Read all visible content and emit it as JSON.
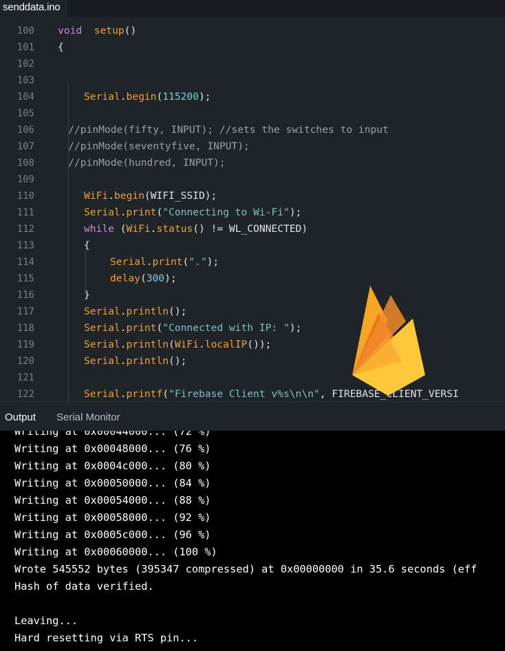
{
  "file_tab": {
    "label": "senddata.ino"
  },
  "editor": {
    "lines": [
      {
        "n": "100",
        "parts": [
          [
            "kw",
            "void"
          ],
          [
            "",
            "  "
          ],
          [
            "fn",
            "setup"
          ],
          [
            "",
            "()"
          ]
        ],
        "indent": 0
      },
      {
        "n": "101",
        "parts": [
          [
            "",
            "{"
          ]
        ],
        "indent": 0
      },
      {
        "n": "102",
        "parts": [],
        "indent": 0
      },
      {
        "n": "103",
        "parts": [],
        "indent": 0
      },
      {
        "n": "104",
        "parts": [
          [
            "cls",
            "Serial"
          ],
          [
            "",
            "."
          ],
          [
            "fn",
            "begin"
          ],
          [
            "",
            "("
          ],
          [
            "num",
            "115200"
          ],
          [
            "",
            ");"
          ]
        ],
        "indent": 1
      },
      {
        "n": "105",
        "parts": [],
        "indent": 0
      },
      {
        "n": "106",
        "parts": [
          [
            "cmt",
            "//pinMode(fifty, INPUT); //sets the switches to input"
          ]
        ],
        "indent": 0.4
      },
      {
        "n": "107",
        "parts": [
          [
            "cmt",
            "//pinMode(seventyfive, INPUT);"
          ]
        ],
        "indent": 0.4
      },
      {
        "n": "108",
        "parts": [
          [
            "cmt",
            "//pinMode(hundred, INPUT);"
          ]
        ],
        "indent": 0.4
      },
      {
        "n": "109",
        "parts": [],
        "indent": 0
      },
      {
        "n": "110",
        "parts": [
          [
            "cls",
            "WiFi"
          ],
          [
            "",
            "."
          ],
          [
            "fn",
            "begin"
          ],
          [
            "",
            "(WIFI_SSID);"
          ]
        ],
        "indent": 1
      },
      {
        "n": "111",
        "parts": [
          [
            "cls",
            "Serial"
          ],
          [
            "",
            "."
          ],
          [
            "fn",
            "print"
          ],
          [
            "",
            "("
          ],
          [
            "str",
            "\"Connecting to Wi-Fi\""
          ],
          [
            "",
            ");"
          ]
        ],
        "indent": 1
      },
      {
        "n": "112",
        "parts": [
          [
            "kw",
            "while"
          ],
          [
            "",
            " ("
          ],
          [
            "cls",
            "WiFi"
          ],
          [
            "",
            "."
          ],
          [
            "fn",
            "status"
          ],
          [
            "",
            "() != WL_CONNECTED)"
          ]
        ],
        "indent": 1
      },
      {
        "n": "113",
        "parts": [
          [
            "",
            "{"
          ]
        ],
        "indent": 1
      },
      {
        "n": "114",
        "parts": [
          [
            "cls",
            "Serial"
          ],
          [
            "",
            "."
          ],
          [
            "fn",
            "print"
          ],
          [
            "",
            "("
          ],
          [
            "str",
            "\".\""
          ],
          [
            "",
            ");"
          ]
        ],
        "indent": 2
      },
      {
        "n": "115",
        "parts": [
          [
            "fn",
            "delay"
          ],
          [
            "",
            "("
          ],
          [
            "num",
            "300"
          ],
          [
            "",
            ");"
          ]
        ],
        "indent": 2
      },
      {
        "n": "116",
        "parts": [
          [
            "",
            "}"
          ]
        ],
        "indent": 1
      },
      {
        "n": "117",
        "parts": [
          [
            "cls",
            "Serial"
          ],
          [
            "",
            "."
          ],
          [
            "fn",
            "println"
          ],
          [
            "",
            "();"
          ]
        ],
        "indent": 1
      },
      {
        "n": "118",
        "parts": [
          [
            "cls",
            "Serial"
          ],
          [
            "",
            "."
          ],
          [
            "fn",
            "print"
          ],
          [
            "",
            "("
          ],
          [
            "str",
            "\"Connected with IP: \""
          ],
          [
            "",
            ");"
          ]
        ],
        "indent": 1
      },
      {
        "n": "119",
        "parts": [
          [
            "cls",
            "Serial"
          ],
          [
            "",
            "."
          ],
          [
            "fn",
            "println"
          ],
          [
            "",
            "("
          ],
          [
            "cls",
            "WiFi"
          ],
          [
            "",
            "."
          ],
          [
            "fn",
            "localIP"
          ],
          [
            "",
            "());"
          ]
        ],
        "indent": 1
      },
      {
        "n": "120",
        "parts": [
          [
            "cls",
            "Serial"
          ],
          [
            "",
            "."
          ],
          [
            "fn",
            "println"
          ],
          [
            "",
            "();"
          ]
        ],
        "indent": 1
      },
      {
        "n": "121",
        "parts": [],
        "indent": 0
      },
      {
        "n": "122",
        "parts": [
          [
            "cls",
            "Serial"
          ],
          [
            "",
            "."
          ],
          [
            "fn",
            "printf"
          ],
          [
            "",
            "("
          ],
          [
            "str",
            "\"Firebase Client v%s\\n\\n\""
          ],
          [
            "",
            ", FIREBASE_CLIENT_VERSI"
          ]
        ],
        "indent": 1
      }
    ]
  },
  "panel": {
    "tab_output": "Output",
    "tab_serial_monitor": "Serial Monitor"
  },
  "output": {
    "lines": [
      "Writing at 0x00044000... (72 %)",
      "Writing at 0x00048000... (76 %)",
      "Writing at 0x0004c000... (80 %)",
      "Writing at 0x00050000... (84 %)",
      "Writing at 0x00054000... (88 %)",
      "Writing at 0x00058000... (92 %)",
      "Writing at 0x0005c000... (96 %)",
      "Writing at 0x00060000... (100 %)",
      "Wrote 545552 bytes (395347 compressed) at 0x00000000 in 35.6 seconds (eff",
      "Hash of data verified.",
      "",
      "Leaving...",
      "Hard resetting via RTS pin..."
    ]
  },
  "colors": {
    "editor_bg": "#1f2428",
    "output_bg": "#000000",
    "keyword": "#c58bdb",
    "function": "#ef9f3b",
    "string": "#79c2c8"
  },
  "icons": {
    "logo": "firebase-logo-icon"
  }
}
